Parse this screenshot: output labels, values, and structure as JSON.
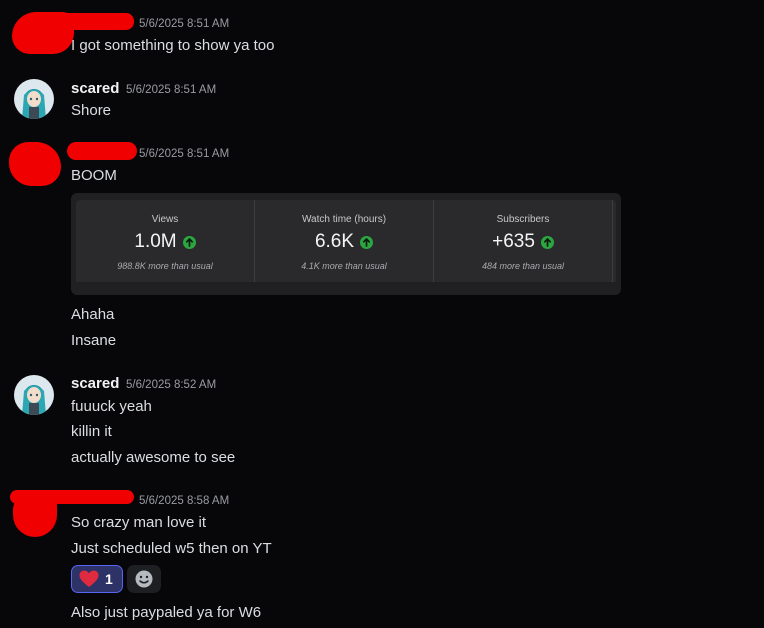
{
  "messages": {
    "m1": {
      "timestamp": "5/6/2025 8:51 AM",
      "lines": [
        "I got something to show ya too"
      ]
    },
    "m2": {
      "author": "scared",
      "timestamp": "5/6/2025 8:51 AM",
      "lines": [
        "Shore"
      ]
    },
    "m3": {
      "timestamp": "5/6/2025 8:51 AM",
      "lines": [
        "BOOM"
      ],
      "after_embed": [
        "Ahaha",
        "Insane"
      ]
    },
    "m4": {
      "author": "scared",
      "timestamp": "5/6/2025 8:52 AM",
      "lines": [
        "fuuuck yeah",
        "killin it",
        "actually awesome to see"
      ]
    },
    "m5": {
      "timestamp": "5/6/2025 8:58 AM",
      "lines": [
        "So crazy man love it",
        "Just scheduled w5 then on YT"
      ],
      "after_reactions": [
        "Also just paypaled ya for W6"
      ]
    }
  },
  "stats_card": {
    "items": [
      {
        "label": "Views",
        "value": "1.0M",
        "sub": "988.8K more than usual"
      },
      {
        "label": "Watch time (hours)",
        "value": "6.6K",
        "sub": "4.1K more than usual"
      },
      {
        "label": "Subscribers",
        "value": "+635",
        "sub": "484 more than usual"
      }
    ],
    "trend_icon": "arrow-up-circle-icon",
    "trend_color": "#2ba640"
  },
  "reactions": [
    {
      "emoji_icon": "heart-icon",
      "count": "1",
      "selected": true
    }
  ],
  "add_reaction_icon": "add-reaction-icon",
  "colors": {
    "background": "#070709",
    "redaction": "#f00000",
    "accent": "#5865f2"
  }
}
